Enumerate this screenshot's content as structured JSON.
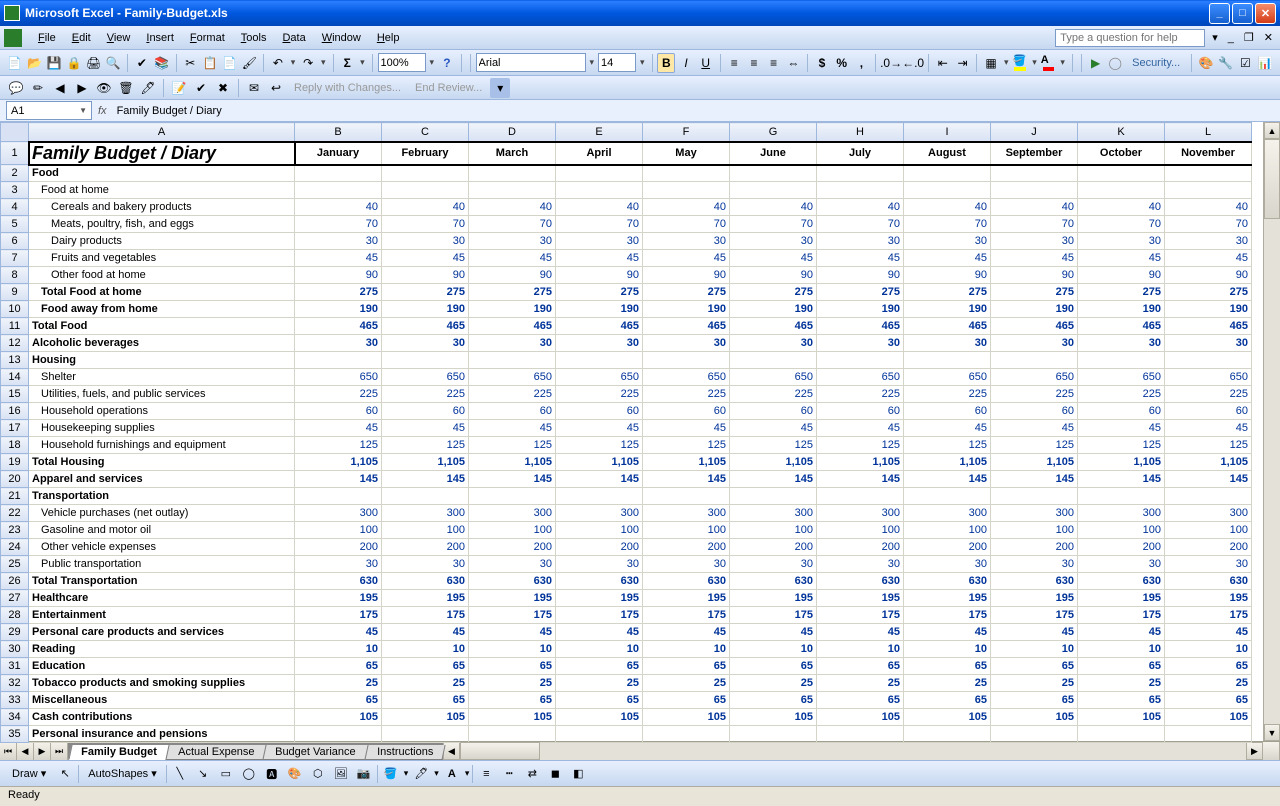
{
  "window": {
    "app": "Microsoft Excel",
    "file": "Family-Budget.xls"
  },
  "menu": [
    "File",
    "Edit",
    "View",
    "Insert",
    "Format",
    "Tools",
    "Data",
    "Window",
    "Help"
  ],
  "help_placeholder": "Type a question for help",
  "toolbar": {
    "zoom": "100%",
    "font": "Arial",
    "size": "14",
    "security": "Security..."
  },
  "review": {
    "reply": "Reply with Changes...",
    "end": "End Review..."
  },
  "formula": {
    "ref": "A1",
    "content": "Family Budget / Diary"
  },
  "columns": [
    "A",
    "B",
    "C",
    "D",
    "E",
    "F",
    "G",
    "H",
    "I",
    "J",
    "K",
    "L"
  ],
  "months": [
    "January",
    "February",
    "March",
    "April",
    "May",
    "June",
    "July",
    "August",
    "September",
    "October",
    "November"
  ],
  "rows": [
    {
      "n": 1,
      "type": "title",
      "label": "Family Budget / Diary"
    },
    {
      "n": 2,
      "type": "cat",
      "label": "Food"
    },
    {
      "n": 3,
      "type": "sub1",
      "label": "Food at home"
    },
    {
      "n": 4,
      "type": "sub2",
      "label": "Cereals and bakery products",
      "val": 40
    },
    {
      "n": 5,
      "type": "sub2",
      "label": "Meats, poultry, fish, and eggs",
      "val": 70
    },
    {
      "n": 6,
      "type": "sub2",
      "label": "Dairy products",
      "val": 30
    },
    {
      "n": 7,
      "type": "sub2",
      "label": "Fruits and vegetables",
      "val": 45
    },
    {
      "n": 8,
      "type": "sub2",
      "label": "Other food at home",
      "val": 90
    },
    {
      "n": 9,
      "type": "bold1",
      "label": "Total Food at home",
      "val": 275
    },
    {
      "n": 10,
      "type": "bold1",
      "label": "Food away from home",
      "val": 190
    },
    {
      "n": 11,
      "type": "boldcat",
      "label": "Total Food",
      "val": 465
    },
    {
      "n": 12,
      "type": "boldcat",
      "label": "Alcoholic beverages",
      "val": 30
    },
    {
      "n": 13,
      "type": "cat",
      "label": "Housing"
    },
    {
      "n": 14,
      "type": "sub1",
      "label": "Shelter",
      "val": 650
    },
    {
      "n": 15,
      "type": "sub1",
      "label": "Utilities, fuels, and public services",
      "val": 225
    },
    {
      "n": 16,
      "type": "sub1",
      "label": "Household operations",
      "val": 60
    },
    {
      "n": 17,
      "type": "sub1",
      "label": "Housekeeping supplies",
      "val": 45
    },
    {
      "n": 18,
      "type": "sub1",
      "label": "Household furnishings and equipment",
      "val": 125
    },
    {
      "n": 19,
      "type": "boldcat",
      "label": "Total Housing",
      "val": "1,105"
    },
    {
      "n": 20,
      "type": "boldcat",
      "label": "Apparel and services",
      "val": 145
    },
    {
      "n": 21,
      "type": "cat",
      "label": "Transportation"
    },
    {
      "n": 22,
      "type": "sub1",
      "label": "Vehicle purchases (net outlay)",
      "val": 300
    },
    {
      "n": 23,
      "type": "sub1",
      "label": "Gasoline and motor oil",
      "val": 100
    },
    {
      "n": 24,
      "type": "sub1",
      "label": "Other vehicle expenses",
      "val": 200
    },
    {
      "n": 25,
      "type": "sub1",
      "label": "Public transportation",
      "val": 30
    },
    {
      "n": 26,
      "type": "boldcat",
      "label": "Total Transportation",
      "val": 630
    },
    {
      "n": 27,
      "type": "boldcat",
      "label": "Healthcare",
      "val": 195
    },
    {
      "n": 28,
      "type": "boldcat",
      "label": "Entertainment",
      "val": 175
    },
    {
      "n": 29,
      "type": "boldcat",
      "label": "Personal care products and services",
      "val": 45
    },
    {
      "n": 30,
      "type": "boldcat",
      "label": "Reading",
      "val": 10
    },
    {
      "n": 31,
      "type": "boldcat",
      "label": "Education",
      "val": 65
    },
    {
      "n": 32,
      "type": "boldcat",
      "label": "Tobacco products and smoking supplies",
      "val": 25
    },
    {
      "n": 33,
      "type": "boldcat",
      "label": "Miscellaneous",
      "val": 65
    },
    {
      "n": 34,
      "type": "boldcat",
      "label": "Cash contributions",
      "val": 105
    },
    {
      "n": 35,
      "type": "cat",
      "label": "Personal insurance and pensions"
    }
  ],
  "tabs": [
    "Family Budget",
    "Actual Expense",
    "Budget Variance",
    "Instructions"
  ],
  "active_tab": 0,
  "draw": {
    "label": "Draw",
    "autoshapes": "AutoShapes"
  },
  "status": "Ready"
}
